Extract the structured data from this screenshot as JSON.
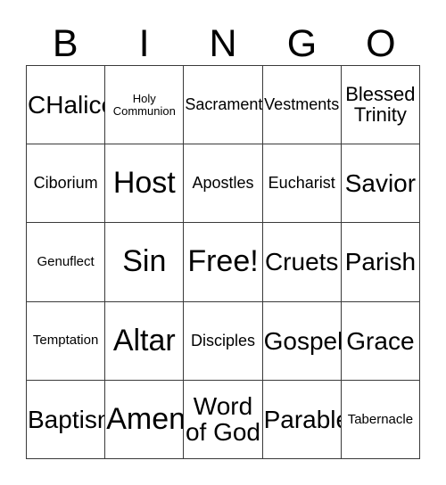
{
  "card": {
    "title": "BINGO",
    "header_letters": [
      "B",
      "I",
      "N",
      "G",
      "O"
    ],
    "free_space_label": "Free!",
    "colors": {
      "background": "#ffffff",
      "text": "#000000",
      "grid_line": "#3a3a3a"
    },
    "grid": {
      "columns": 5,
      "rows": 5,
      "cells": [
        {
          "text": "CHalice",
          "size": "xl"
        },
        {
          "text": "Holy\nCommunion",
          "size": "xs"
        },
        {
          "text": "Sacrament",
          "size": "md"
        },
        {
          "text": "Vestments",
          "size": "md"
        },
        {
          "text": "Blessed\nTrinity",
          "size": "lg"
        },
        {
          "text": "Ciborium",
          "size": "md"
        },
        {
          "text": "Host",
          "size": "xxl"
        },
        {
          "text": "Apostles",
          "size": "md"
        },
        {
          "text": "Eucharist",
          "size": "md"
        },
        {
          "text": "Savior",
          "size": "xl"
        },
        {
          "text": "Genuflect",
          "size": "sm"
        },
        {
          "text": "Sin",
          "size": "xxl"
        },
        {
          "text": "Free!",
          "size": "xxl"
        },
        {
          "text": "Cruets",
          "size": "xl"
        },
        {
          "text": "Parish",
          "size": "xl"
        },
        {
          "text": "Temptation",
          "size": "sm"
        },
        {
          "text": "Altar",
          "size": "xxl"
        },
        {
          "text": "Disciples",
          "size": "md"
        },
        {
          "text": "Gospel",
          "size": "xl"
        },
        {
          "text": "Grace",
          "size": "xl"
        },
        {
          "text": "Baptism",
          "size": "xl"
        },
        {
          "text": "Amen",
          "size": "xxl"
        },
        {
          "text": "Word\nof God",
          "size": "xl"
        },
        {
          "text": "Parable",
          "size": "xl"
        },
        {
          "text": "Tabernacle",
          "size": "sm"
        }
      ]
    }
  }
}
